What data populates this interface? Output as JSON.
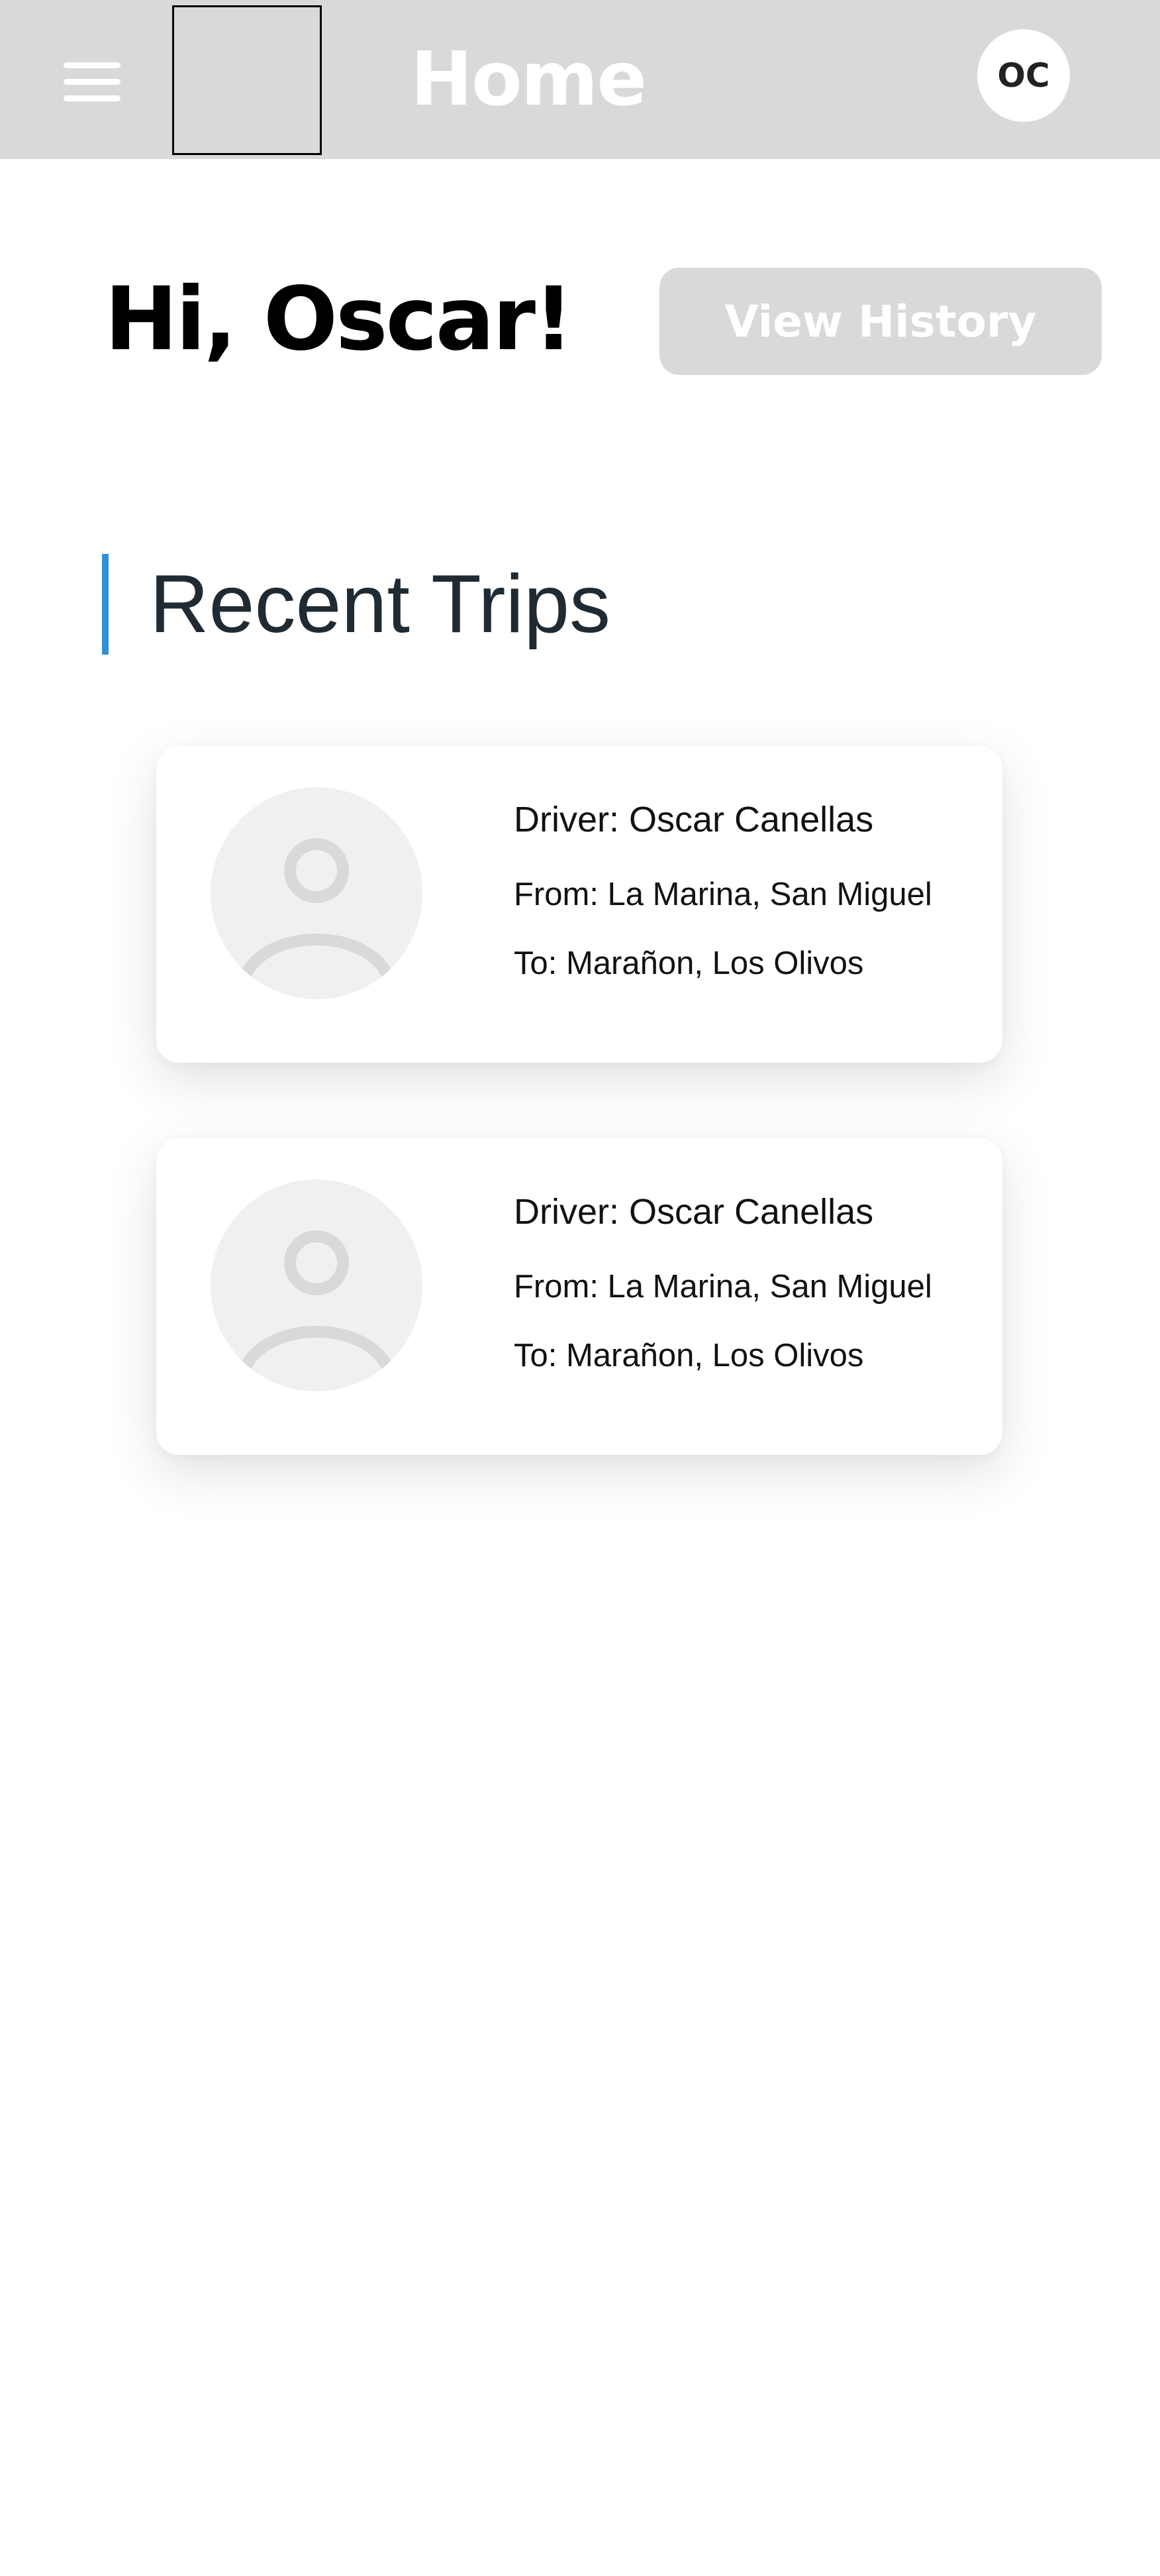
{
  "header": {
    "title": "Home",
    "avatar_initials": "OC",
    "menu_icon": "hamburger-menu-icon",
    "logo": "logo-placeholder",
    "background_color": "#d9d9d9"
  },
  "greeting": {
    "text": "Hi, Oscar!",
    "history_button_label": "View History"
  },
  "recent_trips": {
    "title": "Recent Trips",
    "accent_color": "#3290d6",
    "trips": [
      {
        "driver": "Driver: Oscar Canellas",
        "from": "From: La Marina, San Miguel",
        "to": "To: Marañon, Los Olivos",
        "avatar_icon": "user-avatar-icon"
      },
      {
        "driver": "Driver: Oscar Canellas",
        "from": "From: La Marina, San Miguel",
        "to": "To: Marañon, Los Olivos",
        "avatar_icon": "user-avatar-icon"
      }
    ]
  }
}
